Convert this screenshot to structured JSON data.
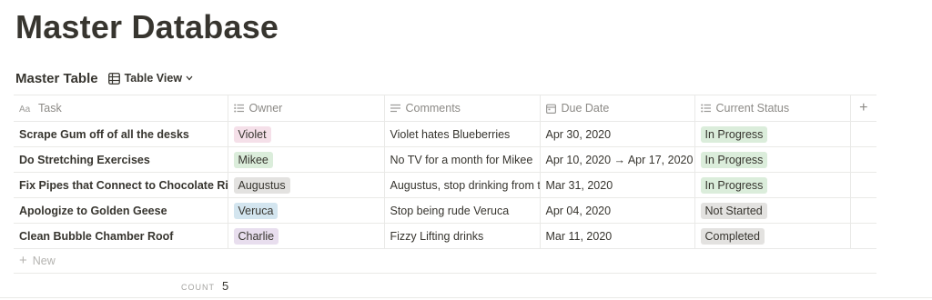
{
  "page": {
    "title": "Master Database"
  },
  "database": {
    "title": "Master Table",
    "view_label": "Table View",
    "view_icon": "table-icon"
  },
  "columns": [
    {
      "label": "Task",
      "icon": "text-property-icon"
    },
    {
      "label": "Owner",
      "icon": "select-list-icon"
    },
    {
      "label": "Comments",
      "icon": "lines-text-icon"
    },
    {
      "label": "Due Date",
      "icon": "calendar-icon"
    },
    {
      "label": "Current Status",
      "icon": "select-list-icon"
    }
  ],
  "add_column_symbol": "+",
  "rows": [
    {
      "task": "Scrape Gum off of all the desks",
      "owner": "Violet",
      "comments": "Violet hates Blueberries",
      "due": "Apr 30, 2020",
      "status": "In Progress"
    },
    {
      "task": "Do Stretching Exercises",
      "owner": "Mikee",
      "comments": "No TV for a month for Mikee",
      "due": "Apr 10, 2020 → Apr 17, 2020",
      "status": "In Progress"
    },
    {
      "task": "Fix Pipes that Connect to Chocolate River",
      "owner": "Augustus",
      "comments": "Augustus, stop drinking from the",
      "due": "Mar 31, 2020",
      "status": "In Progress"
    },
    {
      "task": "Apologize to Golden Geese",
      "owner": "Veruca",
      "comments": "Stop being rude Veruca",
      "due": "Apr 04, 2020",
      "status": "Not Started"
    },
    {
      "task": "Clean Bubble Chamber Roof",
      "owner": "Charlie",
      "comments": "Fizzy Lifting drinks",
      "due": "Mar 11, 2020",
      "status": "Completed"
    }
  ],
  "owner_colors": {
    "Violet": "#f5e0e9",
    "Mikee": "#dbeddb",
    "Augustus": "#e3e2e0",
    "Veruca": "#d3e5ef",
    "Charlie": "#e8deee"
  },
  "status_colors": {
    "In Progress": "#dbeddb",
    "Not Started": "#e3e2e0",
    "Completed": "#e3e2e0"
  },
  "footer": {
    "new_label": "New",
    "new_symbol": "+",
    "count_label": "COUNT",
    "count_value": "5"
  }
}
